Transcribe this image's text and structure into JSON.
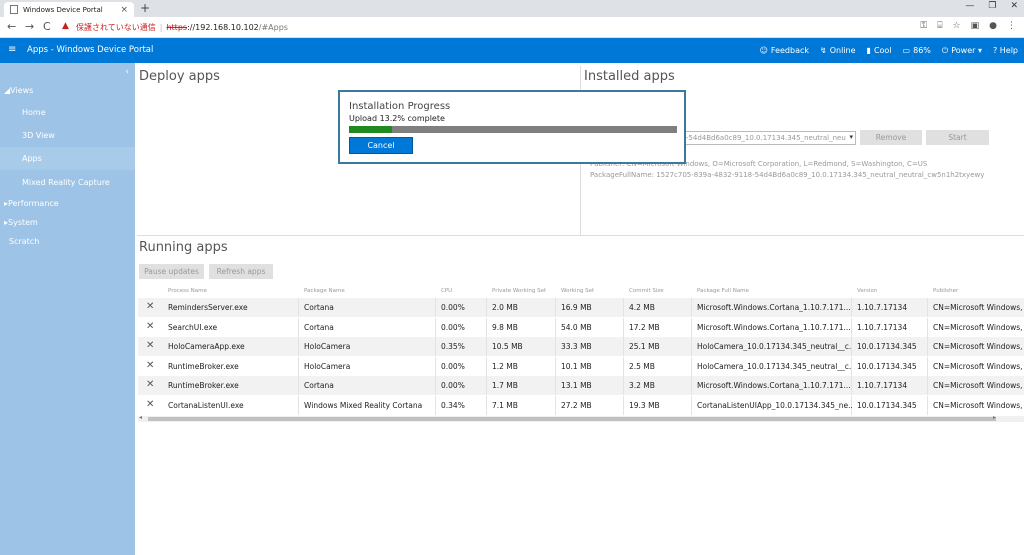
{
  "browser": {
    "tab_title": "Windows Device Portal",
    "new_tab": "+",
    "tab_close": "×",
    "win_min": "—",
    "win_max": "❐",
    "win_close": "✕",
    "back": "←",
    "forward": "→",
    "reload": "C",
    "security_text": "保護されていない通信",
    "url_scheme": "https",
    "url_host": "://192.168.10.102",
    "url_path": "/#Apps"
  },
  "header": {
    "title": "Apps - Windows Device Portal",
    "feedback": "Feedback",
    "online": "Online",
    "cool": "Cool",
    "battery": "86%",
    "power": "Power ▾",
    "help": "? Help"
  },
  "sidebar": {
    "collapse": "‹",
    "views": "◢Views",
    "items": [
      "Home",
      "3D View",
      "Apps",
      "Mixed Reality Capture"
    ],
    "performance": "▸Performance",
    "system": "▸System",
    "scratch": "Scratch"
  },
  "deploy": {
    "title": "Deploy apps"
  },
  "installed": {
    "title": "Installed apps",
    "select_value": "1527c705-839a-4832-9118-54d4Bd6a0c89_10.0.17134.345_neutral_neu",
    "remove": "Remove",
    "start": "Start",
    "publisher": "Publisher: CN=Microsoft Windows, O=Microsoft Corporation, L=Redmond, S=Washington, C=US",
    "package_full_name": "PackageFullName: 1527c705-839a-4832-9118-54d4Bd6a0c89_10.0.17134.345_neutral_neutral_cw5n1h2txyewy"
  },
  "modal": {
    "title": "Installation Progress",
    "status": "Upload 13.2% complete",
    "progress": 0.132,
    "cancel": "Cancel"
  },
  "running": {
    "title": "Running apps",
    "pause": "Pause updates",
    "refresh": "Refresh apps",
    "columns": [
      "Process Name",
      "Package Name",
      "CPU",
      "Private Working Set",
      "Working Set",
      "Commit Size",
      "Package Full Name",
      "Version",
      "Publisher"
    ],
    "rows": [
      [
        "RemindersServer.exe",
        "Cortana",
        "0.00%",
        "2.0 MB",
        "16.9 MB",
        "4.2 MB",
        "Microsoft.Windows.Cortana_1.10.7.171...",
        "1.10.7.17134",
        "CN=Microsoft Windows,"
      ],
      [
        "SearchUI.exe",
        "Cortana",
        "0.00%",
        "9.8 MB",
        "54.0 MB",
        "17.2 MB",
        "Microsoft.Windows.Cortana_1.10.7.171...",
        "1.10.7.17134",
        "CN=Microsoft Windows,"
      ],
      [
        "HoloCameraApp.exe",
        "HoloCamera",
        "0.35%",
        "10.5 MB",
        "33.3 MB",
        "25.1 MB",
        "HoloCamera_10.0.17134.345_neutral__c...",
        "10.0.17134.345",
        "CN=Microsoft Windows,"
      ],
      [
        "RuntimeBroker.exe",
        "HoloCamera",
        "0.00%",
        "1.2 MB",
        "10.1 MB",
        "2.5 MB",
        "HoloCamera_10.0.17134.345_neutral__c...",
        "10.0.17134.345",
        "CN=Microsoft Windows,"
      ],
      [
        "RuntimeBroker.exe",
        "Cortana",
        "0.00%",
        "1.7 MB",
        "13.1 MB",
        "3.2 MB",
        "Microsoft.Windows.Cortana_1.10.7.171...",
        "1.10.7.17134",
        "CN=Microsoft Windows,"
      ],
      [
        "CortanaListenUI.exe",
        "Windows Mixed Reality Cortana",
        "0.34%",
        "7.1 MB",
        "27.2 MB",
        "19.3 MB",
        "CortanaListenUIApp_10.0.17134.345_ne...",
        "10.0.17134.345",
        "CN=Microsoft Windows,"
      ]
    ],
    "kill_icon": "✕"
  },
  "colors": {
    "accent": "#0078d7",
    "sidebar": "#9dc3e6",
    "progress": "#1f8a1f"
  }
}
